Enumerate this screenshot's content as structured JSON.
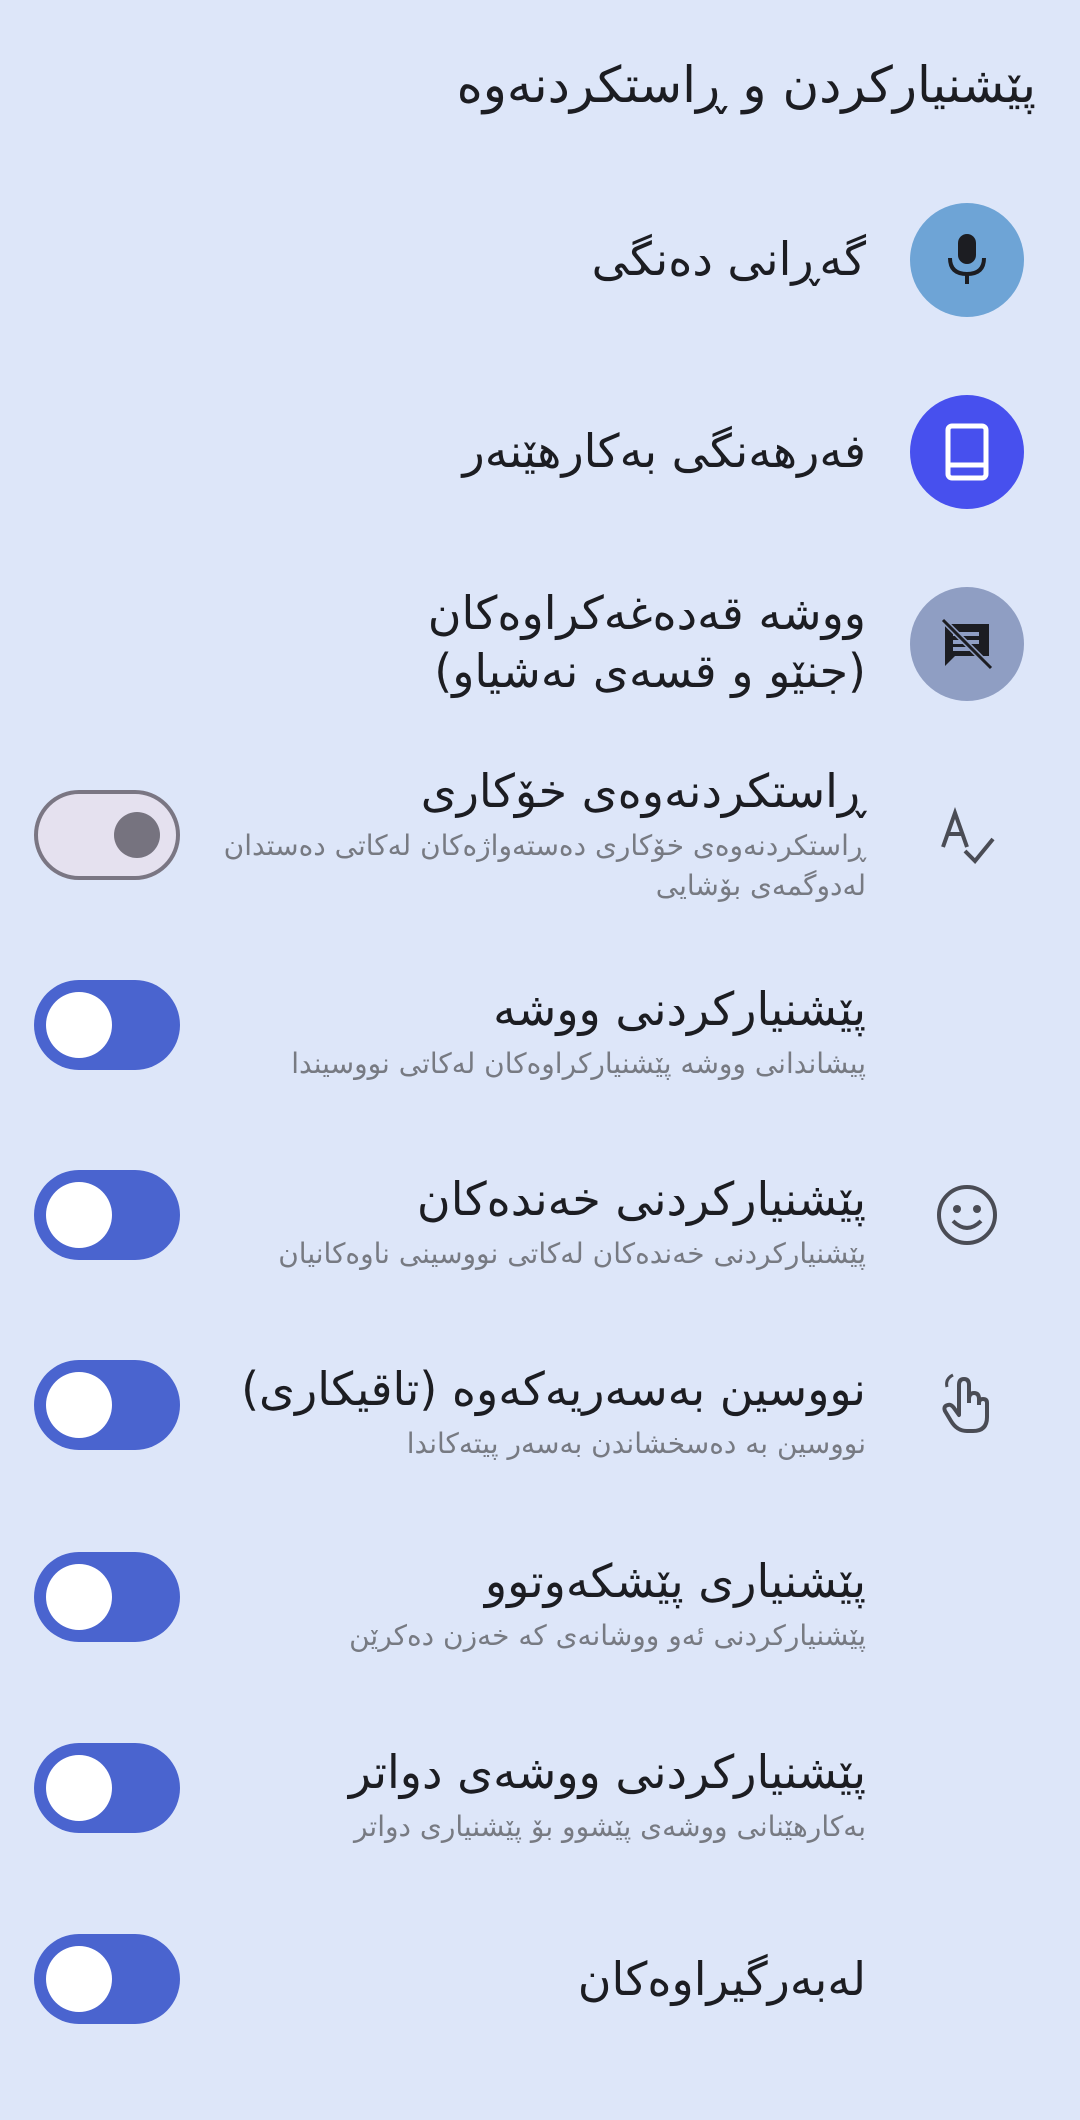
{
  "header": {
    "title": "پێشنیارکردن و ڕاستکردنەوە"
  },
  "items": [
    {
      "title": "گەڕانی دەنگی",
      "icon": "microphone-icon",
      "icon_bg": "#6ea4d6"
    },
    {
      "title": "فەرهەنگی بەکارهێنەر",
      "icon": "dictionary-book-icon",
      "icon_bg": "#4750ee"
    },
    {
      "title_line1": "ووشە قەدەغەکراوەکان",
      "title_line2": "(جنێو و قسەی نەشیاو)",
      "icon": "blocked-words-icon",
      "icon_bg": "#8f9ec3"
    },
    {
      "title": "ڕاستکردنەوەی خۆکاری",
      "subtitle_line1": "ڕاستکردنەوەی خۆکاری دەستەواژەکان لەکاتی دەستدان",
      "subtitle_line2": "لەدوگمەی بۆشایی",
      "icon": "spellcheck-icon",
      "toggle": "off"
    },
    {
      "title": "پێشنیارکردنی ووشە",
      "subtitle": "پیشاندانی ووشە پێشنیارکراوەکان لەکاتی نووسیندا",
      "toggle": "on"
    },
    {
      "title": "پێشنیارکردنی خەندەکان",
      "subtitle": "پێشنیارکردنی خەندەکان لەکاتی نووسینی ناوەکانیان",
      "icon": "smiley-icon",
      "toggle": "on"
    },
    {
      "title": "نووسین بەسەریەکەوە (تاقیکاری)",
      "subtitle": "نووسین بە دەسخشاندن بەسەر پیتەکاندا",
      "icon": "swipe-hand-icon",
      "toggle": "on"
    },
    {
      "title": "پێشنیاری پێشکەوتوو",
      "subtitle": "پێشنیارکردنی ئەو ووشانەی کە خەزن دەکرێن",
      "toggle": "on"
    },
    {
      "title": "پێشنیارکردنی ووشەی دواتر",
      "subtitle": "بەکارهێنانی ووشەی پێشوو بۆ پێشنیاری دواتر",
      "toggle": "on"
    },
    {
      "title": "لەبەرگیراوەکان",
      "toggle": "on"
    }
  ],
  "colors": {
    "background": "#dde6f9",
    "toggle_on": "#4a64cf",
    "toggle_off_track": "#e5e1ef",
    "text_primary": "#1c1d22",
    "text_secondary": "#777a82"
  }
}
